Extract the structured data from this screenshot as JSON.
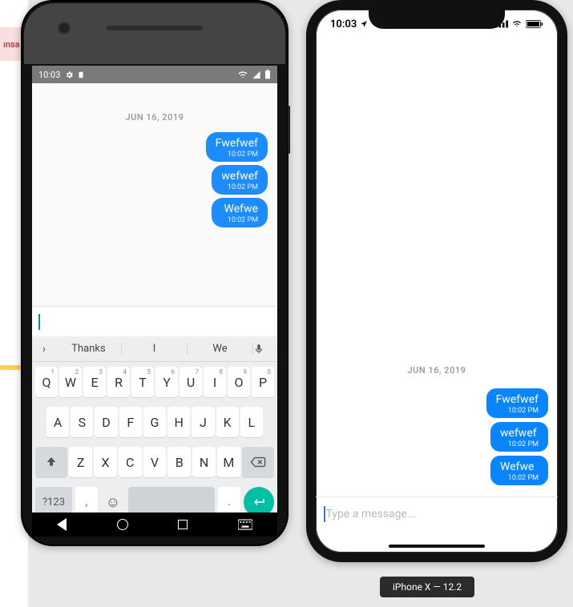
{
  "bg": {
    "alert_text": "ınsa"
  },
  "android": {
    "status": {
      "time": "10:03",
      "icons": [
        "gear",
        "bell",
        "wifi",
        "signal",
        "battery"
      ]
    },
    "date_label": "JUN 16, 2019",
    "messages": [
      {
        "text": "Fwefwef",
        "time": "10:02 PM"
      },
      {
        "text": "wefwef",
        "time": "10:02 PM"
      },
      {
        "text": "Wefwe",
        "time": "10:02 PM"
      }
    ],
    "input": {
      "placeholder": ""
    },
    "keyboard": {
      "suggestions": [
        "Thanks",
        "I",
        "We"
      ],
      "row1": [
        {
          "k": "Q",
          "n": "1"
        },
        {
          "k": "W",
          "n": "2"
        },
        {
          "k": "E",
          "n": "3"
        },
        {
          "k": "R",
          "n": "4"
        },
        {
          "k": "T",
          "n": "5"
        },
        {
          "k": "Y",
          "n": "6"
        },
        {
          "k": "U",
          "n": "7"
        },
        {
          "k": "I",
          "n": "8"
        },
        {
          "k": "O",
          "n": "9"
        },
        {
          "k": "P",
          "n": "0"
        }
      ],
      "row2": [
        "A",
        "S",
        "D",
        "F",
        "G",
        "H",
        "J",
        "K",
        "L"
      ],
      "row3": [
        "Z",
        "X",
        "C",
        "V",
        "B",
        "N",
        "M"
      ],
      "sym": "?123",
      "comma": ",",
      "dot": "."
    }
  },
  "ios": {
    "status": {
      "time": "10:03"
    },
    "date_label": "JUN 16, 2019",
    "messages": [
      {
        "text": "Fwefwef",
        "time": "10:02 PM"
      },
      {
        "text": "wefwef",
        "time": "10:02 PM"
      },
      {
        "text": "Wefwe",
        "time": "10:02 PM"
      }
    ],
    "input": {
      "placeholder": "Type a message..."
    },
    "device_label": "iPhone X — 12.2"
  }
}
